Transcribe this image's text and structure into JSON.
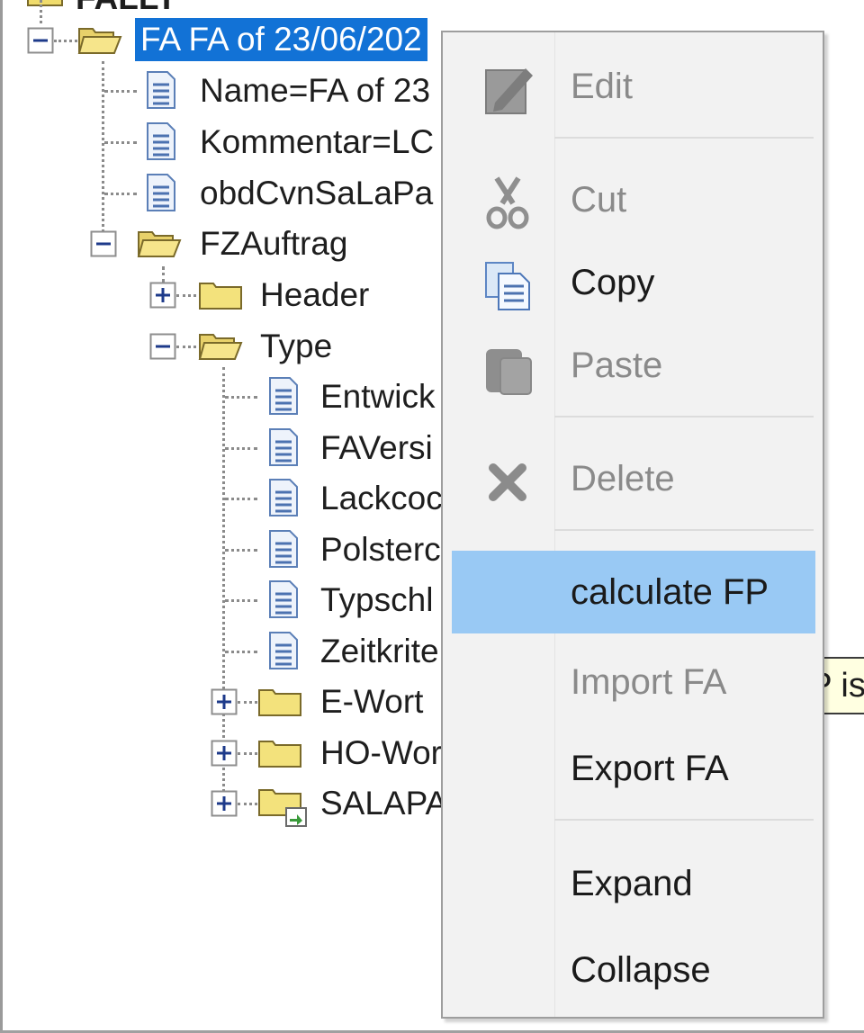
{
  "tree": {
    "top_partial_label": "FALLT",
    "root": {
      "label": "FA FA of 23/06/202",
      "toggle": "minus"
    },
    "root_children": [
      {
        "label": "Name=FA of 23",
        "type": "document"
      },
      {
        "label": "Kommentar=LC",
        "type": "document"
      },
      {
        "label": "obdCvnSaLaPa",
        "type": "document"
      }
    ],
    "fzauftrag": {
      "label": "FZAuftrag",
      "toggle": "minus"
    },
    "header": {
      "label": "Header",
      "toggle": "plus"
    },
    "type": {
      "label": "Type",
      "toggle": "minus"
    },
    "type_children": [
      {
        "label": "Entwick",
        "type": "document"
      },
      {
        "label": "FAVersi",
        "type": "document"
      },
      {
        "label": "Lackcoc",
        "type": "document"
      },
      {
        "label": "Polsterc",
        "type": "document"
      },
      {
        "label": "Typschl",
        "type": "document"
      },
      {
        "label": "Zeitkrite",
        "type": "document"
      }
    ],
    "folders_after": [
      {
        "label": "E-Wort",
        "toggle": "plus"
      },
      {
        "label": "HO-Wor",
        "toggle": "plus"
      },
      {
        "label": "SALAPA",
        "toggle": "plus"
      }
    ]
  },
  "context_menu": {
    "items": [
      {
        "label": "Edit",
        "icon": "pencil-icon",
        "enabled": false
      },
      {
        "label": "Cut",
        "icon": "scissors-icon",
        "enabled": false
      },
      {
        "label": "Copy",
        "icon": "copy-icon",
        "enabled": true
      },
      {
        "label": "Paste",
        "icon": "paste-icon",
        "enabled": false
      },
      {
        "label": "Delete",
        "icon": "delete-x-icon",
        "enabled": false
      },
      {
        "label": "calculate FP",
        "icon": "",
        "enabled": true,
        "highlighted": true
      },
      {
        "label": "Import FA",
        "icon": "",
        "enabled": false
      },
      {
        "label": "Export FA",
        "icon": "",
        "enabled": true
      },
      {
        "label": "Expand",
        "icon": "",
        "enabled": true
      },
      {
        "label": "Collapse",
        "icon": "",
        "enabled": true
      }
    ]
  },
  "tooltip": {
    "text": "FP is"
  },
  "colors": {
    "selection": "#1272d6",
    "menu_highlight": "#99c9f4",
    "menu_background": "#f2f2f2",
    "tooltip_background": "#ffffe1",
    "disabled_text": "#8a8a8a"
  }
}
